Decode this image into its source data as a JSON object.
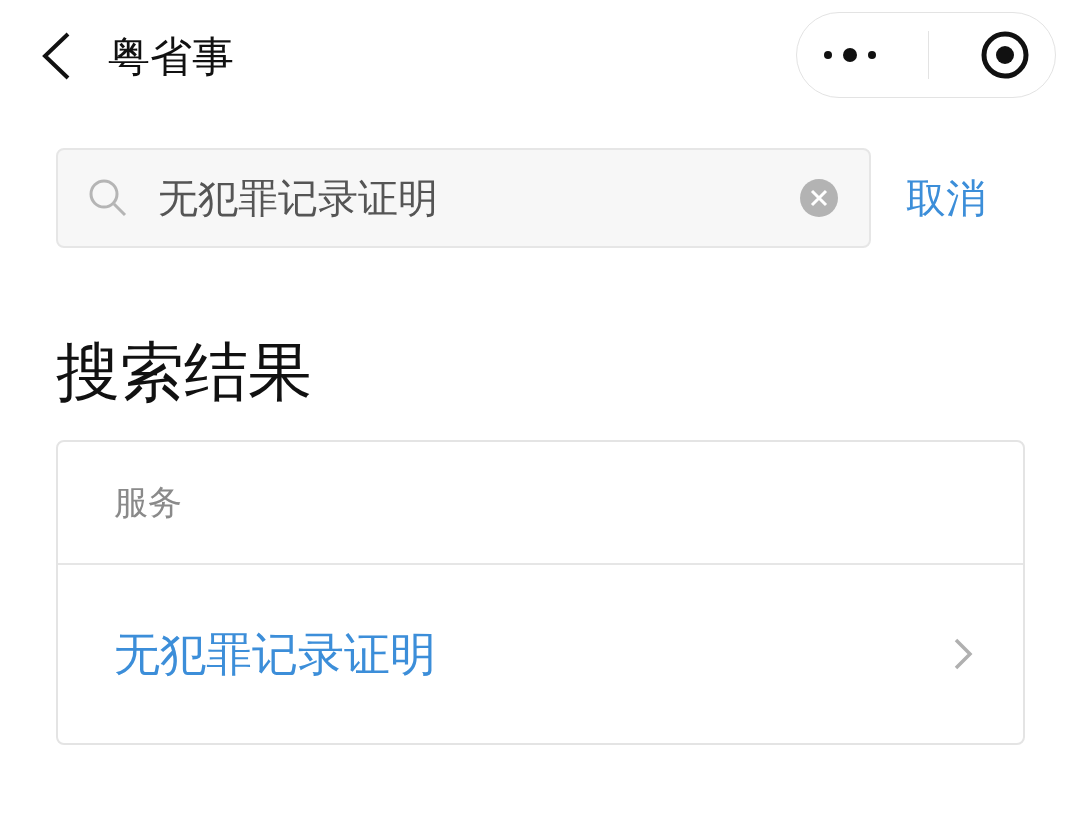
{
  "window": {
    "title": "粤省事"
  },
  "search": {
    "value": "无犯罪记录证明",
    "cancel": "取消"
  },
  "results": {
    "heading": "搜索结果",
    "section": "服务",
    "items": [
      {
        "label": "无犯罪记录证明"
      }
    ]
  }
}
